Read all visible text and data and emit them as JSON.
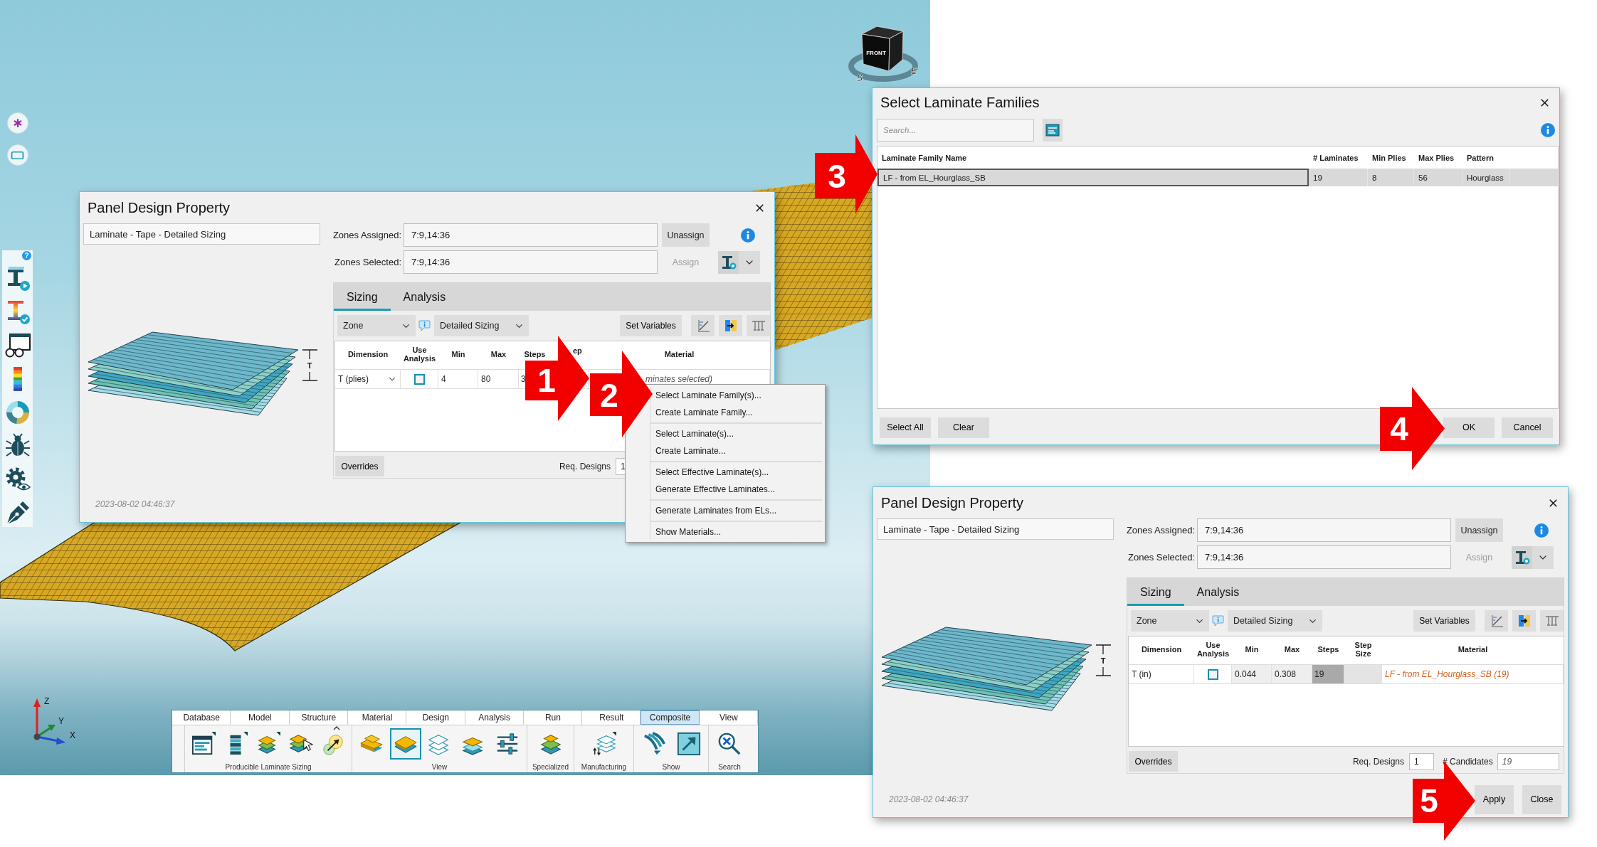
{
  "viewport": {
    "view_cube": {
      "face": "FRONT",
      "compass": [
        "S",
        "E"
      ]
    },
    "palette_help": "?",
    "axes": [
      "Z",
      "Y",
      "X"
    ]
  },
  "ribbon": {
    "tabs": [
      {
        "label": "Database",
        "selected": false
      },
      {
        "label": "Model",
        "selected": false
      },
      {
        "label": "Structure",
        "selected": false
      },
      {
        "label": "Material",
        "selected": false
      },
      {
        "label": "Design",
        "selected": false
      },
      {
        "label": "Analysis",
        "selected": false
      },
      {
        "label": "Run",
        "selected": false
      },
      {
        "label": "Result",
        "selected": false
      },
      {
        "label": "Composite",
        "selected": true
      },
      {
        "label": "View",
        "selected": false
      }
    ],
    "groups": [
      {
        "label": "Producible Laminate Sizing",
        "tools": [
          {
            "kind": "table",
            "selected": false
          },
          {
            "kind": "bars",
            "selected": false
          },
          {
            "kind": "plies",
            "selected": false
          },
          {
            "kind": "cursor",
            "selected": false
          },
          {
            "kind": "target",
            "selected": false
          }
        ]
      },
      {
        "label": "View",
        "tools": [
          {
            "kind": "stepped",
            "selected": false
          },
          {
            "kind": "ply",
            "selected": true
          },
          {
            "kind": "outline",
            "selected": false
          },
          {
            "kind": "striped",
            "selected": false
          },
          {
            "kind": "sliders",
            "selected": false
          }
        ]
      },
      {
        "label": "Specialized",
        "tools": [
          {
            "kind": "patches",
            "selected": false
          }
        ]
      },
      {
        "label": "Manufacturing",
        "tools": [
          {
            "kind": "layers",
            "selected": false
          }
        ]
      },
      {
        "label": "Show",
        "tools": [
          {
            "kind": "sweep",
            "selected": false
          },
          {
            "kind": "export",
            "selected": false
          }
        ]
      },
      {
        "label": "Search",
        "tools": [
          {
            "kind": "search",
            "selected": false
          }
        ]
      }
    ]
  },
  "panel_before": {
    "title": "Panel Design Property",
    "name": "Laminate - Tape - Detailed Sizing",
    "zones": [
      {
        "label": "Zones Assigned:",
        "value": "7:9,14:36"
      },
      {
        "label": "Zones Selected:",
        "value": "7:9,14:36"
      }
    ],
    "zone_buttons": [
      {
        "label": "Unassign",
        "disabled": false
      },
      {
        "label": "Assign",
        "disabled": true
      }
    ],
    "dimension_label": "T",
    "tabs": [
      {
        "label": "Sizing",
        "selected": true
      },
      {
        "label": "Analysis",
        "selected": false
      }
    ],
    "scope": "Zone",
    "method": "Detailed Sizing",
    "set_variables": "Set Variables",
    "columns": [
      "Dimension",
      "Use Analysis",
      "Min",
      "Max",
      "Steps",
      "ep",
      "Material"
    ],
    "rows": [
      {
        "dimension": "T (plies)",
        "dropdown": true,
        "use_analysis": false,
        "min": "4",
        "max": "80",
        "steps": "3",
        "material": "minates selected)",
        "material_assigned": false,
        "computed": false
      }
    ],
    "overrides": "Overrides",
    "req_designs": {
      "label": "Req. Designs",
      "value": "1"
    },
    "timestamp": "2023-08-02 04:46:37"
  },
  "context_menu": {
    "sections": [
      {
        "items": [
          "Select Laminate Family(s)...",
          "Create Laminate Family..."
        ]
      },
      {
        "items": [
          "Select Laminate(s)...",
          "Create Laminate..."
        ]
      },
      {
        "items": [
          "Select Effective Laminate(s)...",
          "Generate Effective Laminates..."
        ]
      },
      {
        "items": [
          "Generate Laminates from ELs..."
        ]
      },
      {
        "items": [
          "Show Materials..."
        ]
      }
    ]
  },
  "family_dialog": {
    "title": "Select Laminate Families",
    "search": {
      "placeholder": "Search..."
    },
    "columns": [
      "Laminate Family Name",
      "# Laminates",
      "Min Plies",
      "Max Plies",
      "Pattern"
    ],
    "rows": [
      {
        "cells": [
          "LF - from EL_Hourglass_SB",
          "19",
          "8",
          "56",
          "Hourglass"
        ],
        "selected": true
      }
    ],
    "buttons_left": [
      "Select All",
      "Clear"
    ],
    "buttons_right": [
      "OK",
      "Cancel"
    ]
  },
  "panel_after": {
    "title": "Panel Design Property",
    "name": "Laminate - Tape - Detailed Sizing",
    "zones": [
      {
        "label": "Zones Assigned:",
        "value": "7:9,14:36"
      },
      {
        "label": "Zones Selected:",
        "value": "7:9,14:36"
      }
    ],
    "zone_buttons": [
      {
        "label": "Unassign",
        "disabled": false
      },
      {
        "label": "Assign",
        "disabled": true
      }
    ],
    "dimension_label": "T",
    "tabs": [
      {
        "label": "Sizing",
        "selected": true
      },
      {
        "label": "Analysis",
        "selected": false
      }
    ],
    "scope": "Zone",
    "method": "Detailed Sizing",
    "set_variables": "Set Variables",
    "columns": [
      "Dimension",
      "Use Analysis",
      "Min",
      "Max",
      "Steps",
      "Step Size",
      "Material"
    ],
    "rows": [
      {
        "dimension": "T (in)",
        "dropdown": false,
        "use_analysis": false,
        "min": "0.044",
        "max": "0.308",
        "steps": "19",
        "material": "LF - from EL_Hourglass_SB (19)",
        "material_assigned": true,
        "computed": true
      }
    ],
    "overrides": "Overrides",
    "req_designs": {
      "label": "Req. Designs",
      "value": "1"
    },
    "candidates": {
      "label": "# Candidates",
      "value": "19"
    },
    "timestamp": "2023-08-02 04:46:37",
    "buttons": [
      "Apply",
      "Close"
    ]
  },
  "callouts": [
    {
      "number": "1"
    },
    {
      "number": "2"
    },
    {
      "number": "3"
    },
    {
      "number": "4"
    },
    {
      "number": "5"
    }
  ]
}
